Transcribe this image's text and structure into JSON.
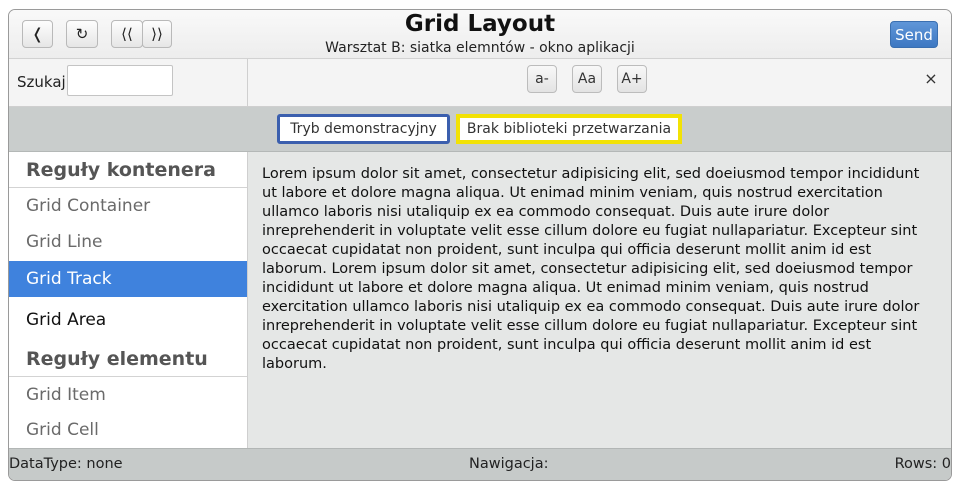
{
  "window": {
    "title": "Grid Layout",
    "subtitle": "Warsztat B: siatka elemntów - okno aplikacji"
  },
  "titlebar": {
    "back_label": "❬",
    "reload_label": "↻",
    "first_label": "⟨⟨",
    "last_label": "⟩⟩",
    "send_label": "Send"
  },
  "toolbar": {
    "search_label": "Szukaj",
    "search_value": "",
    "font_decrease": "a-",
    "font_reset": "Aa",
    "font_increase": "A+",
    "close_label": "×"
  },
  "modes": {
    "demo_label": "Tryb demonstracyjny",
    "library_label": "Brak biblioteki przetwarzania"
  },
  "sidebar": {
    "section1": "Reguły kontenera",
    "section1_items": [
      "Grid Container",
      "Grid Line",
      "Grid Track",
      "Grid Area"
    ],
    "section2": "Reguły elementu",
    "section2_items": [
      "Grid Item",
      "Grid Cell"
    ],
    "active_item": "Grid Track"
  },
  "content": {
    "text": "Lorem ipsum dolor sit amet, consectetur adipisicing elit, sed doeiusmod tempor incididunt ut labore et dolore magna aliqua. Ut enimad minim veniam, quis nostrud exercitation ullamco laboris nisi utaliquip ex ea commodo consequat. Duis aute irure dolor inreprehenderit in voluptate velit esse cillum dolore eu fugiat nullapariatur. Excepteur sint occaecat cupidatat non proident, sunt inculpa qui officia deserunt mollit anim id est laborum. Lorem ipsum dolor sit amet, consectetur adipisicing elit, sed doeiusmod tempor incididunt ut labore et dolore magna aliqua. Ut enimad minim veniam, quis nostrud exercitation ullamco laboris nisi utaliquip ex ea commodo consequat. Duis aute irure dolor inreprehenderit in voluptate velit esse cillum dolore eu fugiat nullapariatur. Excepteur sint occaecat cupidatat non proident, sunt inculpa qui officia deserunt mollit anim id est laborum."
  },
  "statusbar": {
    "datatype": "DataType: none",
    "navigation": "Nawigacja:",
    "rows": "Rows: 0"
  },
  "colors": {
    "accent": "#3f82dd",
    "send_button": "#4a84cc",
    "demo_border": "#3b5fae",
    "library_border": "#f2e205"
  }
}
